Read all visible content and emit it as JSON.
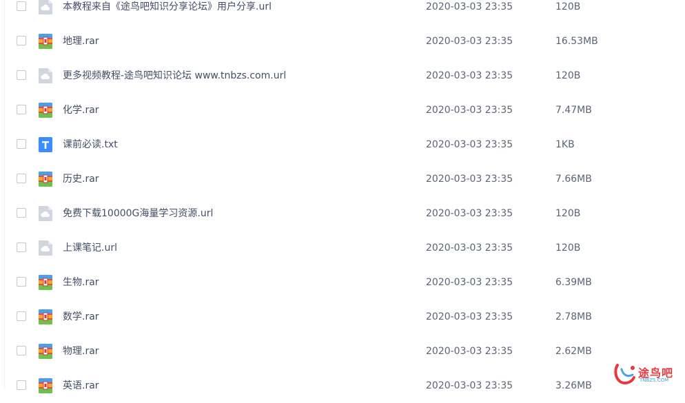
{
  "files": [
    {
      "name": "本教程来自《途鸟吧知识分享论坛》用户分享.url",
      "icon": "url-file-icon",
      "date": "2020-03-03 23:35",
      "size": "120B"
    },
    {
      "name": "地理.rar",
      "icon": "rar-archive-icon",
      "date": "2020-03-03 23:35",
      "size": "16.53MB"
    },
    {
      "name": "更多视频教程-途鸟吧知识论坛 www.tnbzs.com.url",
      "icon": "url-file-icon",
      "date": "2020-03-03 23:35",
      "size": "120B"
    },
    {
      "name": "化学.rar",
      "icon": "rar-archive-icon",
      "date": "2020-03-03 23:35",
      "size": "7.47MB"
    },
    {
      "name": "课前必读.txt",
      "icon": "txt-file-icon",
      "date": "2020-03-03 23:35",
      "size": "1KB"
    },
    {
      "name": "历史.rar",
      "icon": "rar-archive-icon",
      "date": "2020-03-03 23:35",
      "size": "7.66MB"
    },
    {
      "name": "免费下载10000G海量学习资源.url",
      "icon": "url-file-icon",
      "date": "2020-03-03 23:35",
      "size": "120B"
    },
    {
      "name": "上课笔记.url",
      "icon": "url-file-icon",
      "date": "2020-03-03 23:35",
      "size": "120B"
    },
    {
      "name": "生物.rar",
      "icon": "rar-archive-icon",
      "date": "2020-03-03 23:35",
      "size": "6.39MB"
    },
    {
      "name": "数学.rar",
      "icon": "rar-archive-icon",
      "date": "2020-03-03 23:35",
      "size": "2.78MB"
    },
    {
      "name": "物理.rar",
      "icon": "rar-archive-icon",
      "date": "2020-03-03 23:35",
      "size": "2.62MB"
    },
    {
      "name": "英语.rar",
      "icon": "rar-archive-icon",
      "date": "2020-03-03 23:35",
      "size": "3.26MB"
    }
  ],
  "watermark": {
    "text": "途鸟吧",
    "subtext": "TNBZS.COM"
  },
  "colors": {
    "text": "#424e67",
    "border": "#c3c8d1",
    "url_icon": "#cfd6e0",
    "txt_icon": "#3b8cff",
    "watermark_red": "#e8383d",
    "watermark_blue": "#4aa3df"
  }
}
